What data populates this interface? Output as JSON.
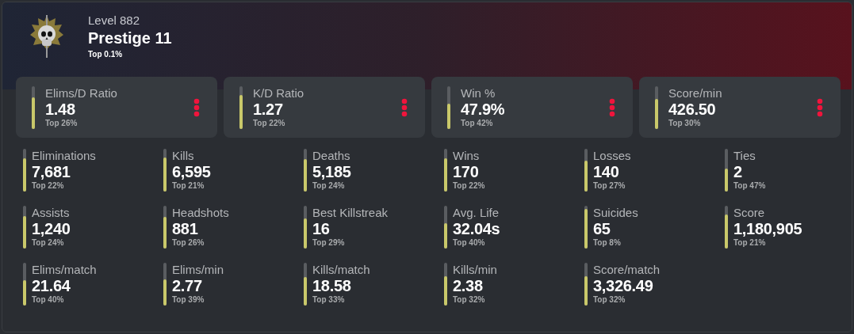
{
  "profile": {
    "level": "Level 882",
    "rank": "Prestige 11",
    "percentile": "Top 0.1%"
  },
  "featured": [
    {
      "label": "Elims/D Ratio",
      "value": "1.48",
      "percentile": "Top 26%",
      "level": 0.74
    },
    {
      "label": "K/D Ratio",
      "value": "1.27",
      "percentile": "Top 22%",
      "level": 0.78
    },
    {
      "label": "Win %",
      "value": "47.9%",
      "percentile": "Top 42%",
      "level": 0.58
    },
    {
      "label": "Score/min",
      "value": "426.50",
      "percentile": "Top 30%",
      "level": 0.7
    }
  ],
  "stats": [
    {
      "label": "Eliminations",
      "value": "7,681",
      "percentile": "Top 22%",
      "level": 0.78
    },
    {
      "label": "Kills",
      "value": "6,595",
      "percentile": "Top 21%",
      "level": 0.79
    },
    {
      "label": "Deaths",
      "value": "5,185",
      "percentile": "Top 24%",
      "level": 0.76
    },
    {
      "label": "Wins",
      "value": "170",
      "percentile": "Top 22%",
      "level": 0.78
    },
    {
      "label": "Losses",
      "value": "140",
      "percentile": "Top 27%",
      "level": 0.73
    },
    {
      "label": "Ties",
      "value": "2",
      "percentile": "Top 47%",
      "level": 0.53
    },
    {
      "label": "Assists",
      "value": "1,240",
      "percentile": "Top 24%",
      "level": 0.76
    },
    {
      "label": "Headshots",
      "value": "881",
      "percentile": "Top 26%",
      "level": 0.74
    },
    {
      "label": "Best Killstreak",
      "value": "16",
      "percentile": "Top 29%",
      "level": 0.71
    },
    {
      "label": "Avg. Life",
      "value": "32.04s",
      "percentile": "Top 40%",
      "level": 0.6
    },
    {
      "label": "Suicides",
      "value": "65",
      "percentile": "Top 8%",
      "level": 0.92
    },
    {
      "label": "Score",
      "value": "1,180,905",
      "percentile": "Top 21%",
      "level": 0.79
    },
    {
      "label": "Elims/match",
      "value": "21.64",
      "percentile": "Top 40%",
      "level": 0.6
    },
    {
      "label": "Elims/min",
      "value": "2.77",
      "percentile": "Top 39%",
      "level": 0.61
    },
    {
      "label": "Kills/match",
      "value": "18.58",
      "percentile": "Top 33%",
      "level": 0.67
    },
    {
      "label": "Kills/min",
      "value": "2.38",
      "percentile": "Top 32%",
      "level": 0.68
    },
    {
      "label": "Score/match",
      "value": "3,326.49",
      "percentile": "Top 32%",
      "level": 0.68
    }
  ]
}
